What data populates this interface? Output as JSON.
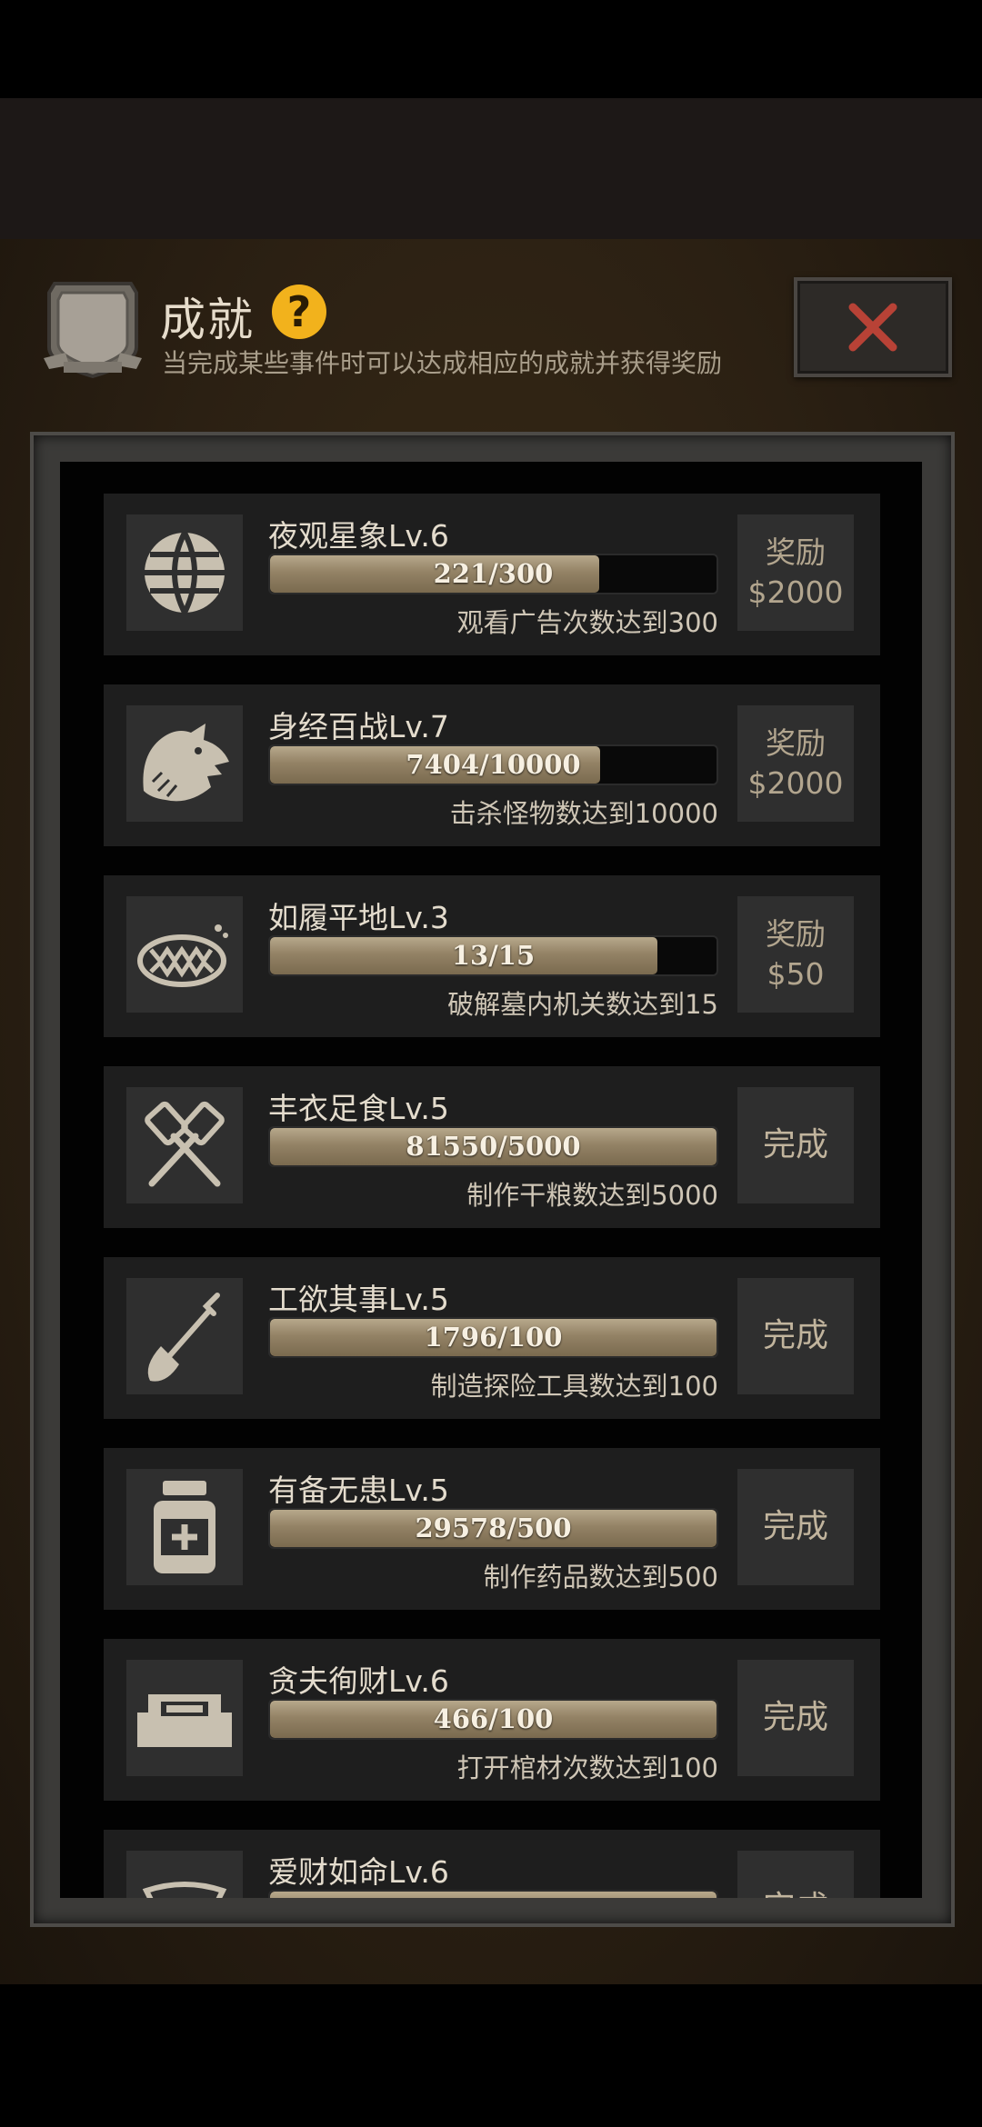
{
  "header": {
    "title": "成就",
    "subtitle": "当完成某些事件时可以达成相应的成就并获得奖励",
    "help_label": "?"
  },
  "achievements": [
    {
      "title": "夜观星象Lv.6",
      "progress_text": "221/300",
      "progress": 0.737,
      "desc": "观看广告次数达到300",
      "icon": "globe-icon",
      "reward_label": "奖励",
      "reward_amount": "$2000"
    },
    {
      "title": "身经百战Lv.7",
      "progress_text": "7404/10000",
      "progress": 0.74,
      "desc": "击杀怪物数达到10000",
      "icon": "wolf-icon",
      "reward_label": "奖励",
      "reward_amount": "$2000"
    },
    {
      "title": "如履平地Lv.3",
      "progress_text": "13/15",
      "progress": 0.867,
      "desc": "破解墓内机关数达到15",
      "icon": "trap-icon",
      "reward_label": "奖励",
      "reward_amount": "$50"
    },
    {
      "title": "丰衣足食Lv.5",
      "progress_text": "81550/5000",
      "progress": 1,
      "desc": "制作干粮数达到5000",
      "icon": "spatula-icon",
      "reward_label": "完成",
      "reward_amount": ""
    },
    {
      "title": "工欲其事Lv.5",
      "progress_text": "1796/100",
      "progress": 1,
      "desc": "制造探险工具数达到100",
      "icon": "shovel-icon",
      "reward_label": "完成",
      "reward_amount": ""
    },
    {
      "title": "有备无患Lv.5",
      "progress_text": "29578/500",
      "progress": 1,
      "desc": "制作药品数达到500",
      "icon": "medicine-bottle-icon",
      "reward_label": "完成",
      "reward_amount": ""
    },
    {
      "title": "贪夫徇财Lv.6",
      "progress_text": "466/100",
      "progress": 1,
      "desc": "打开棺材次数达到100",
      "icon": "coffin-icon",
      "reward_label": "完成",
      "reward_amount": ""
    },
    {
      "title": "爱财如命Lv.6",
      "progress_text": "",
      "progress": 1,
      "desc": "",
      "icon": "gold-ingot-icon",
      "reward_label": "完成",
      "reward_amount": ""
    }
  ]
}
